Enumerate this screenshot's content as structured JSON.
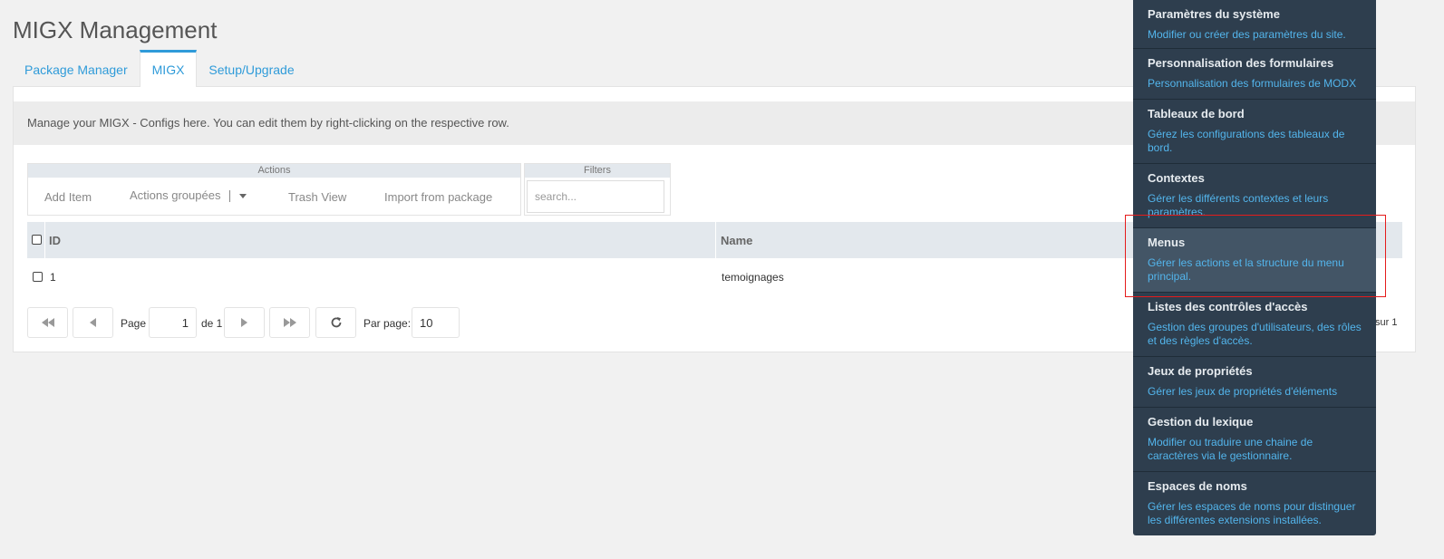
{
  "page": {
    "title": "MIGX Management"
  },
  "tabs": [
    {
      "label": "Package Manager",
      "active": false
    },
    {
      "label": "MIGX",
      "active": true
    },
    {
      "label": "Setup/Upgrade",
      "active": false
    }
  ],
  "panel": {
    "description": "Manage your MIGX - Configs here. You can edit them by right-clicking on the respective row."
  },
  "toolbar": {
    "actions_title": "Actions",
    "filters_title": "Filters",
    "add_item": "Add Item",
    "grouped_actions": "Actions groupées",
    "trash_view": "Trash View",
    "import_from_package": "Import from package",
    "search_placeholder": "search..."
  },
  "grid": {
    "columns": [
      "ID",
      "Name"
    ],
    "rows": [
      {
        "id": "1",
        "name": "temoignages"
      }
    ]
  },
  "pager": {
    "page_label": "Page",
    "page_value": "1",
    "of_label": "de 1",
    "per_page_label": "Par page:",
    "per_page_value": "10",
    "total_suffix": "sur 1"
  },
  "menu": {
    "items": [
      {
        "title": "Paramètres du système",
        "desc": "Modifier ou créer des paramètres du site."
      },
      {
        "title": "Personnalisation des formulaires",
        "desc": "Personnalisation des formulaires de MODX"
      },
      {
        "title": "Tableaux de bord",
        "desc": "Gérez les configurations des tableaux de bord."
      },
      {
        "title": "Contextes",
        "desc": "Gérer les différents contextes et leurs paramètres."
      },
      {
        "title": "Menus",
        "desc": "Gérer les actions et la structure du menu principal."
      },
      {
        "title": "Listes des contrôles d'accès",
        "desc": "Gestion des groupes d'utilisateurs, des rôles et des règles d'accès."
      },
      {
        "title": "Jeux de propriétés",
        "desc": "Gérer les jeux de propriétés d'éléments"
      },
      {
        "title": "Gestion du lexique",
        "desc": "Modifier ou traduire une chaine de caractères via le gestionnaire."
      },
      {
        "title": "Espaces de noms",
        "desc": "Gérer les espaces de noms pour distinguer les différentes extensions installées."
      }
    ],
    "hovered_index": 4
  },
  "colors": {
    "accent": "#2f9bd9",
    "menu_bg": "#2e3e4e",
    "menu_hover": "#435566",
    "menu_link": "#53b5ec",
    "highlight": "#e51c1c"
  }
}
